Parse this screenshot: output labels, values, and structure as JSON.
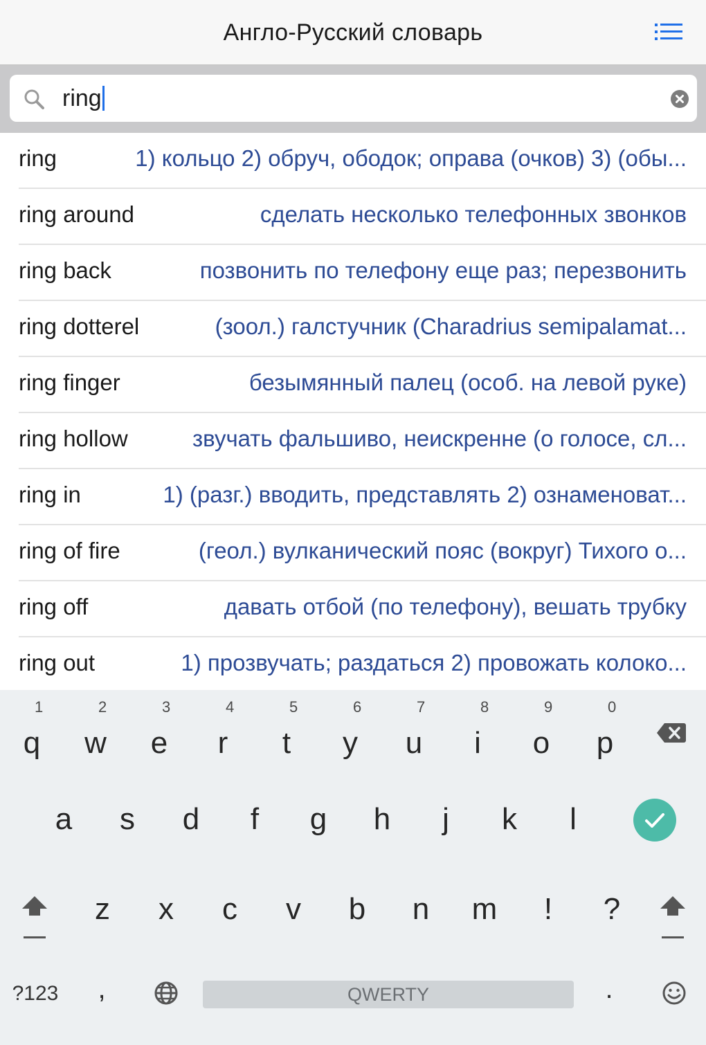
{
  "header": {
    "title": "Англо-Русский словарь",
    "menu_icon": "list-icon",
    "accent": "#1f6fe8"
  },
  "search": {
    "value": "ring",
    "search_icon": "search-icon",
    "clear_icon": "clear-icon"
  },
  "results": [
    {
      "word": "ring",
      "translation": "1) кольцо  2) обруч, ободок; оправа (очков)  3) (обы..."
    },
    {
      "word": "ring around",
      "translation": "сделать несколько телефонных звонков"
    },
    {
      "word": "ring back",
      "translation": "позвонить по телефону еще раз; перезвонить"
    },
    {
      "word": "ring dotterel",
      "translation": "(зоол.) галстучник (Charadrius semipalamat..."
    },
    {
      "word": "ring finger",
      "translation": "безымянный палец (особ. на левой руке)"
    },
    {
      "word": "ring hollow",
      "translation": "звучать фальшиво, неискренне (о голосе, сл..."
    },
    {
      "word": "ring in",
      "translation": "1) (разг.) вводить, представлять  2) ознаменоват..."
    },
    {
      "word": "ring of fire",
      "translation": "(геол.) вулканический пояс (вокруг) Тихого о..."
    },
    {
      "word": "ring off",
      "translation": "давать отбой (по телефону), вешать трубку"
    },
    {
      "word": "ring out",
      "translation": "1) прозвучать; раздаться  2) провожать колоко..."
    }
  ],
  "keyboard": {
    "row1": [
      {
        "ch": "q",
        "hint": "1"
      },
      {
        "ch": "w",
        "hint": "2"
      },
      {
        "ch": "e",
        "hint": "3"
      },
      {
        "ch": "r",
        "hint": "4"
      },
      {
        "ch": "t",
        "hint": "5"
      },
      {
        "ch": "y",
        "hint": "6"
      },
      {
        "ch": "u",
        "hint": "7"
      },
      {
        "ch": "i",
        "hint": "8"
      },
      {
        "ch": "o",
        "hint": "9"
      },
      {
        "ch": "p",
        "hint": "0"
      }
    ],
    "row2": [
      "a",
      "s",
      "d",
      "f",
      "g",
      "h",
      "j",
      "k",
      "l"
    ],
    "row3": [
      "z",
      "x",
      "c",
      "v",
      "b",
      "n",
      "m",
      "!",
      "?"
    ],
    "symbols_label": "?123",
    "comma_label": ",",
    "period_label": ".",
    "space_label": "QWERTY",
    "icons": {
      "backspace": "backspace-icon",
      "enter": "check-icon",
      "shift": "shift-icon",
      "language": "globe-icon",
      "emoji": "emoji-icon"
    },
    "enter_color": "#4dbba8"
  }
}
